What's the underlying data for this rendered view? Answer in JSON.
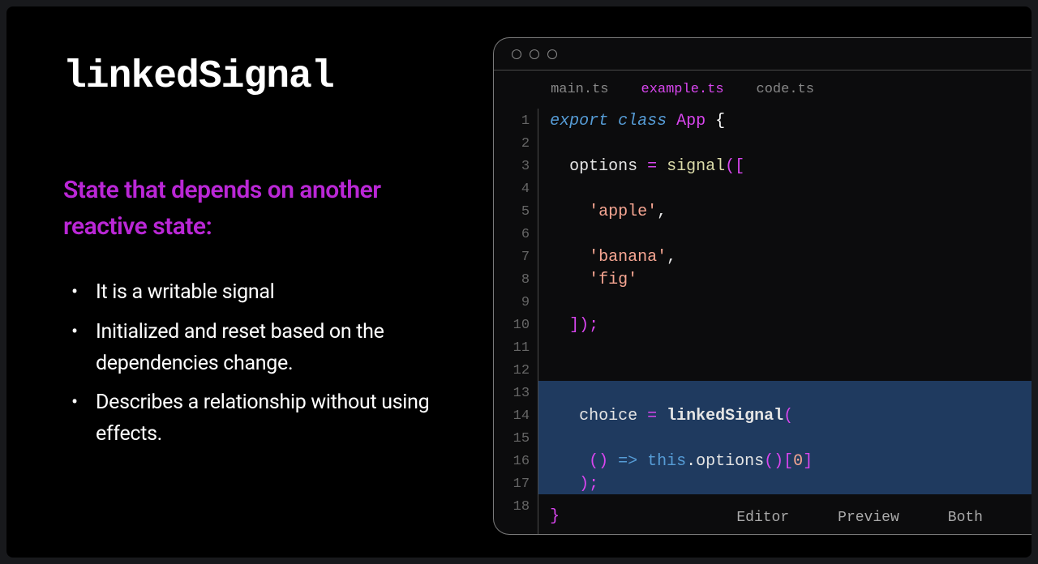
{
  "heading": "linkedSignal",
  "subheading": "State that depends on another reactive state:",
  "bullets": [
    "It is a writable signal",
    "Initialized and reset based on the dependencies change.",
    "Describes a relationship without using effects."
  ],
  "editor": {
    "tabs": [
      "main.ts",
      "example.ts",
      "code.ts"
    ],
    "active_tab_index": 1,
    "line_count": 18,
    "footer": [
      "Editor",
      "Preview",
      "Both"
    ],
    "code": {
      "l1_export": "export",
      "l1_class": "class",
      "l1_App": "App",
      "l1_brace": " {",
      "l3_options": "  options ",
      "l3_eq": "=",
      "l3_signal": " signal",
      "l3_paren": "([",
      "l5_apple": "    'apple'",
      "l5_comma": ",",
      "l7_banana": "    'banana'",
      "l7_comma": ",",
      "l8_fig": "    'fig'",
      "l10_close": "  ]);",
      "l14_choice": "   choice ",
      "l14_eq": "=",
      "l14_linked": " linkedSignal",
      "l14_paren": "(",
      "l16_arrow_open": "    () ",
      "l16_arrow": "=>",
      "l16_this": " this",
      "l16_dot": ".",
      "l16_options": "options",
      "l16_call": "()[",
      "l16_zero": "0",
      "l16_close": "]",
      "l17_close": "   );",
      "l_end": "}"
    }
  }
}
